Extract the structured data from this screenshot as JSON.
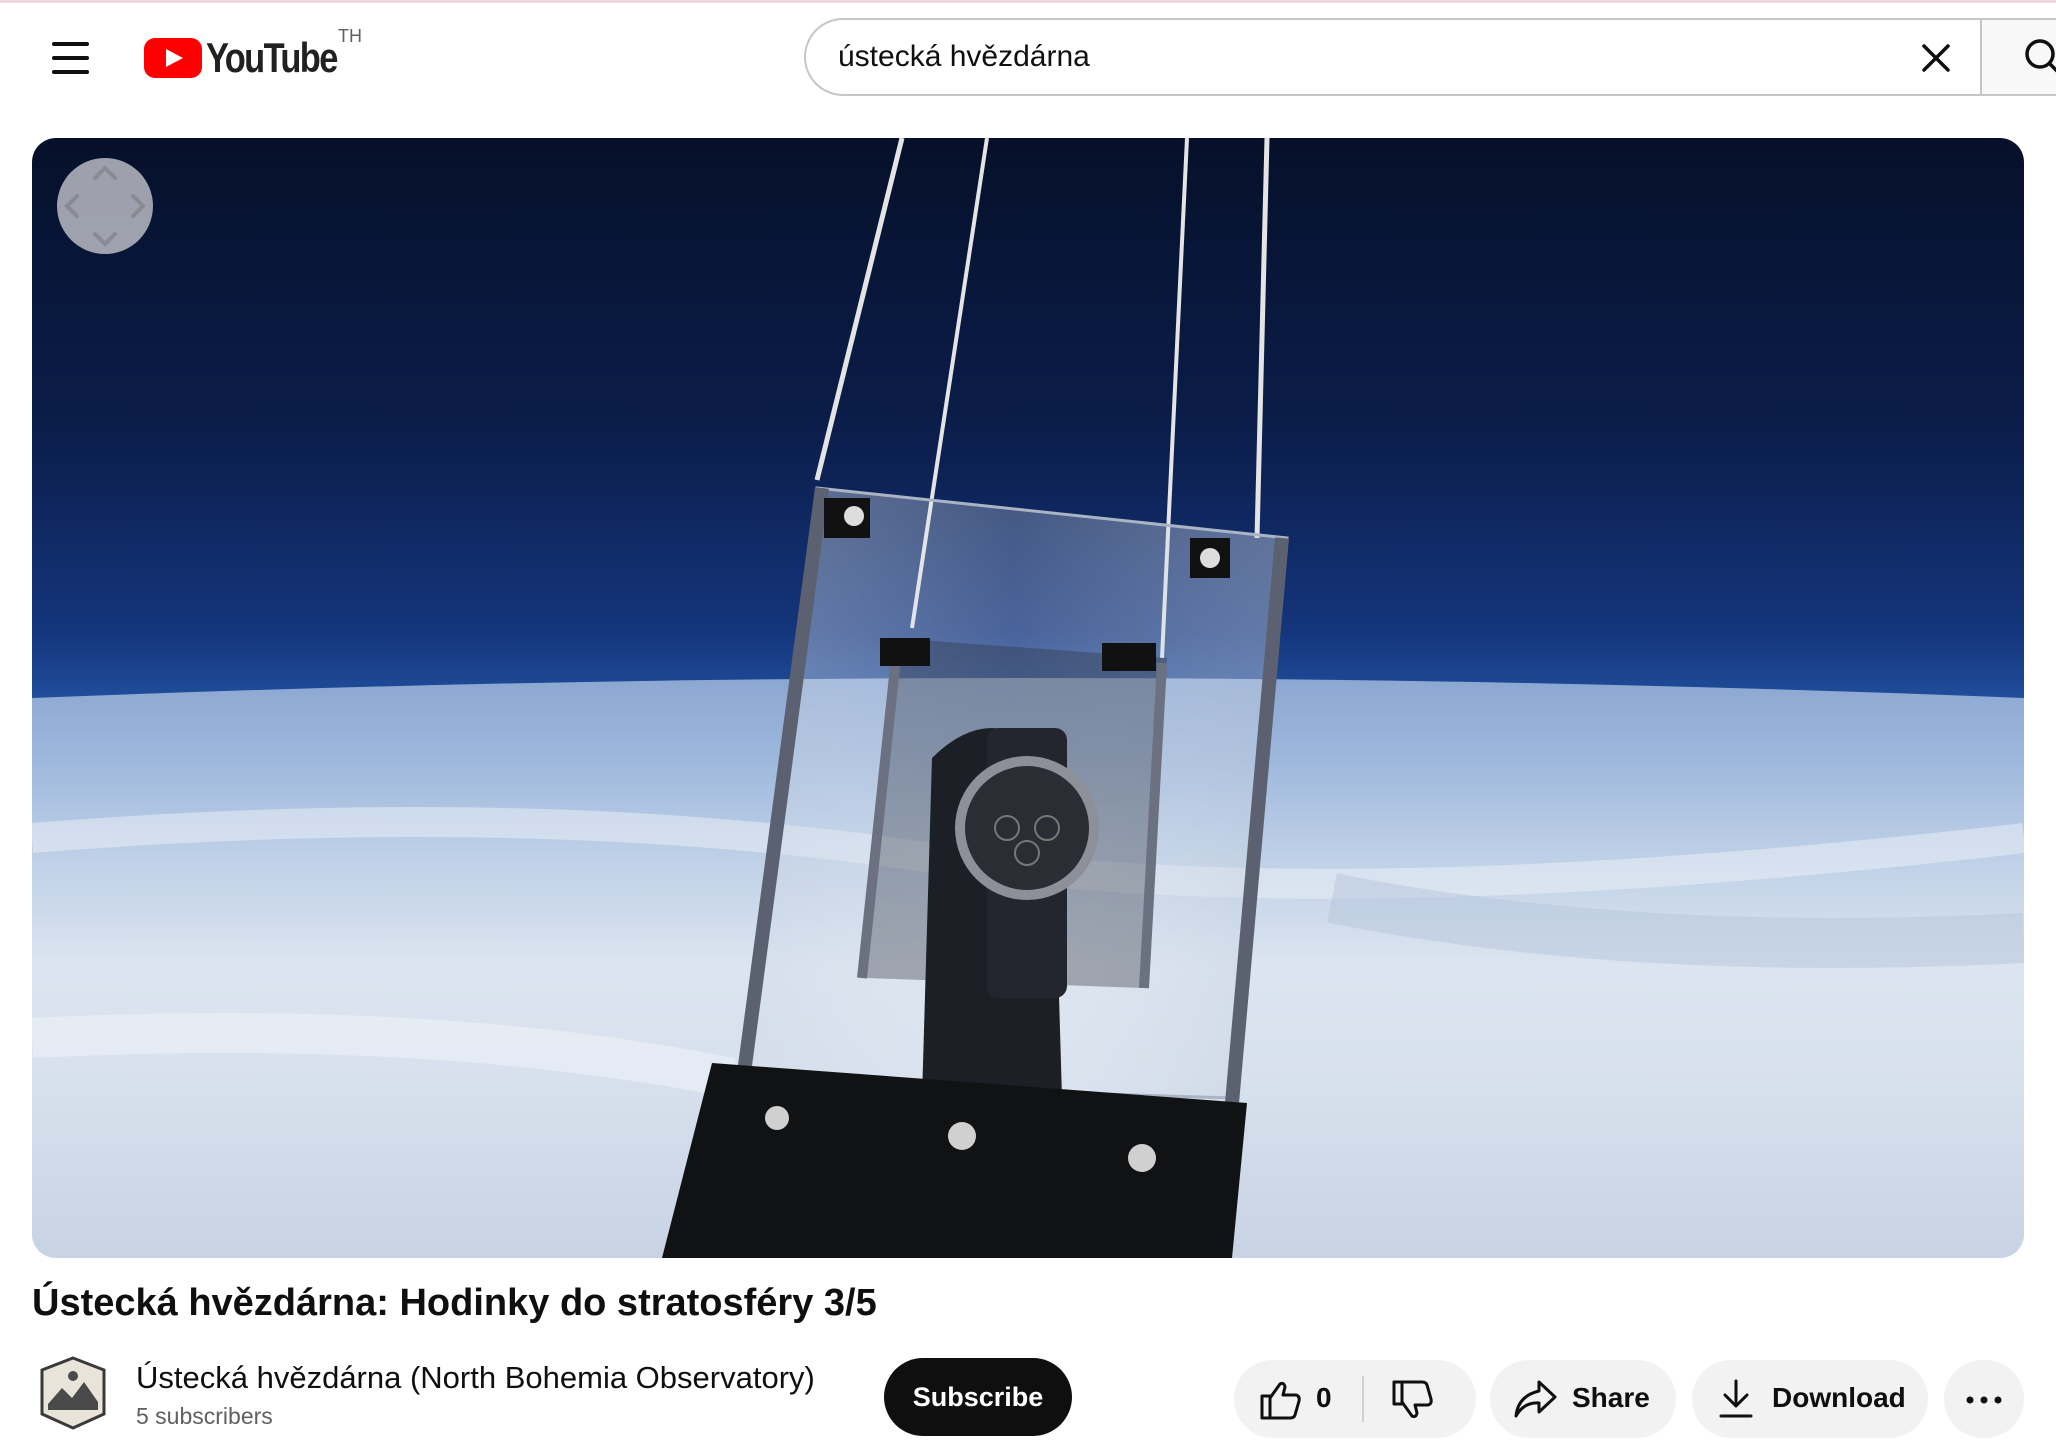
{
  "masthead": {
    "logo_text": "YouTube",
    "region": "TH",
    "search": {
      "value": "ústecká hvězdárna"
    }
  },
  "video": {
    "title": "Ústecká hvězdárna: Hodinky do stratosféry 3/5",
    "channel": {
      "name": "Ústecká hvězdárna (North Bohemia Observatory)",
      "subscribers": "5 subscribers"
    },
    "actions": {
      "subscribe_label": "Subscribe",
      "like_count": "0",
      "share_label": "Share",
      "download_label": "Download"
    }
  },
  "colors": {
    "brand_red": "#ff0000",
    "button_dark": "#0f0f0f",
    "pill_bg": "#f2f2f2",
    "secondary_text": "#606060"
  },
  "icons": [
    "menu-icon",
    "youtube-logo-icon",
    "clear-icon",
    "search-icon",
    "360-navigation-icon",
    "like-icon",
    "dislike-icon",
    "share-icon",
    "download-icon",
    "more-icon"
  ]
}
